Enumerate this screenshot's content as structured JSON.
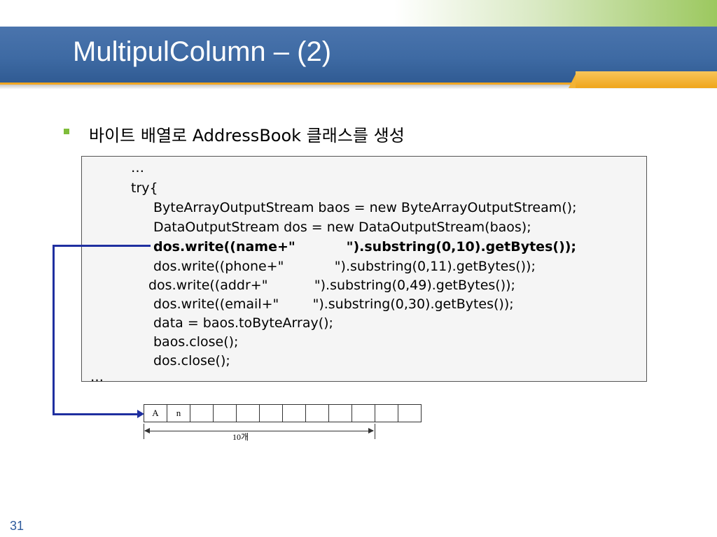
{
  "slide": {
    "title": "MultipulColumn – (2)",
    "bullet": "바이트 배열로 AddressBook 클래스를 생성",
    "page_number": "31"
  },
  "code": {
    "lines": [
      "…",
      "try{",
      "ByteArrayOutputStream baos = new ByteArrayOutputStream();",
      "DataOutputStream dos = new DataOutputStream(baos);",
      "dos.write((name+\"           \").substring(0,10).getBytes());",
      "dos.write((phone+\"            \").substring(0,11).getBytes());",
      "dos.write((addr+\"           \").substring(0,49).getBytes());",
      "dos.write((email+\"        \").substring(0,30).getBytes());",
      "data = baos.toByteArray();",
      "baos.close();",
      "dos.close();",
      "…"
    ]
  },
  "byte_array": {
    "cells": [
      "A",
      "n",
      "",
      "",
      "",
      "",
      "",
      "",
      "",
      "",
      "",
      "",
      ""
    ],
    "dimension_label": "10개"
  },
  "colors": {
    "title_band": "#3e6aa3",
    "accent_orange": "#f0a623",
    "bullet_green": "#7fbd3a",
    "connector_blue": "#1f2fa0",
    "page_number": "#2e5a9c"
  }
}
